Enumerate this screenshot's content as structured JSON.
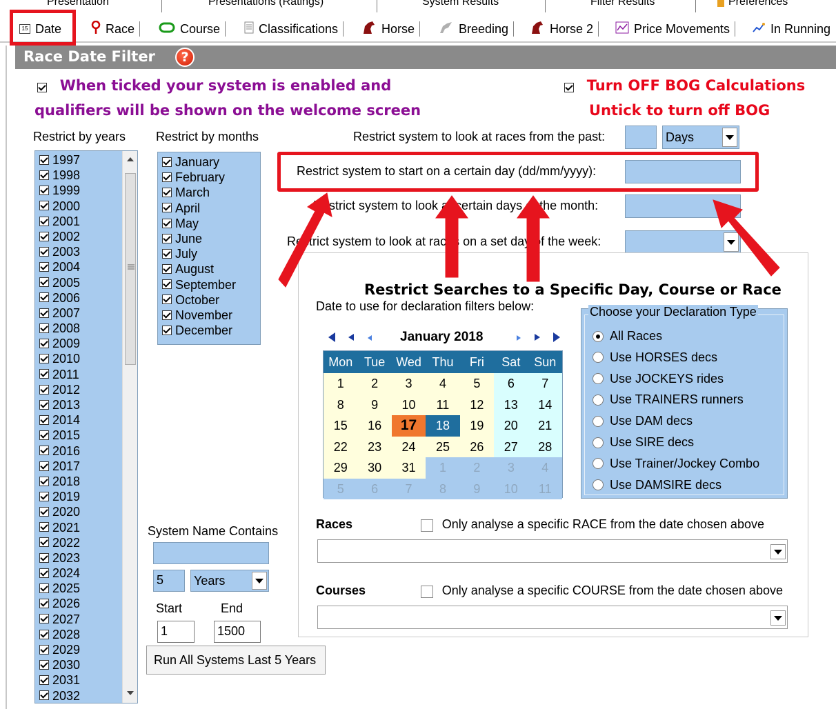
{
  "top_tabs": [
    {
      "label": "Presentation"
    },
    {
      "label": "Presentations (Ratings)"
    },
    {
      "label": "System Results"
    },
    {
      "label": "Filter Results"
    },
    {
      "label": "Preferences"
    }
  ],
  "tabs": [
    {
      "label": "Date",
      "icon": "calendar-icon"
    },
    {
      "label": "Race",
      "icon": "pin-icon"
    },
    {
      "label": "Course",
      "icon": "course-icon"
    },
    {
      "label": "Classifications",
      "icon": "document-icon"
    },
    {
      "label": "Horse",
      "icon": "horse-icon"
    },
    {
      "label": "Breeding",
      "icon": "breeding-icon"
    },
    {
      "label": "Horse 2",
      "icon": "horse-icon"
    },
    {
      "label": "Price Movements",
      "icon": "chart-icon"
    },
    {
      "label": "In Running",
      "icon": "line-chart-icon"
    }
  ],
  "header": {
    "title": "Race Date Filter",
    "help": "?"
  },
  "enable_system": {
    "line1": "When ticked your system is enabled and",
    "line2": "qualifiers will be shown on the welcome screen",
    "checked": true
  },
  "bog": {
    "line1": "Turn OFF BOG Calculations",
    "line2": "Untick to turn off BOG",
    "checked": true
  },
  "years": {
    "label": "Restrict by years",
    "items": [
      "1997",
      "1998",
      "1999",
      "2000",
      "2001",
      "2002",
      "2003",
      "2004",
      "2005",
      "2006",
      "2007",
      "2008",
      "2009",
      "2010",
      "2011",
      "2012",
      "2013",
      "2014",
      "2015",
      "2016",
      "2017",
      "2018",
      "2019",
      "2020",
      "2021",
      "2022",
      "2023",
      "2024",
      "2025",
      "2026",
      "2027",
      "2028",
      "2029",
      "2030",
      "2031",
      "2032"
    ]
  },
  "months": {
    "label": "Restrict by months",
    "items": [
      "January",
      "February",
      "March",
      "April",
      "May",
      "June",
      "July",
      "August",
      "September",
      "October",
      "November",
      "December"
    ]
  },
  "restrict": {
    "past_label": "Restrict system to look at races from the past:",
    "past_value": "",
    "past_unit": "Days",
    "start_label": "Restrict system to start on a certain day (dd/mm/yyyy):",
    "start_value": "",
    "dom_label": "Restrict system to look at certain days of the month:",
    "dom_value": "",
    "dow_label": "Restrict system to look at races on a set day of the week:",
    "dow_value": ""
  },
  "specific": {
    "title": "Restrict Searches to a Specific Day, Course or Race",
    "date_label": "Date to use for declaration filters below:"
  },
  "calendar": {
    "month": "January 2018",
    "days_header": [
      "Mon",
      "Tue",
      "Wed",
      "Thu",
      "Fri",
      "Sat",
      "Sun"
    ],
    "weeks": [
      [
        "1",
        "2",
        "3",
        "4",
        "5",
        "6",
        "7"
      ],
      [
        "8",
        "9",
        "10",
        "11",
        "12",
        "13",
        "14"
      ],
      [
        "15",
        "16",
        "17",
        "18",
        "19",
        "20",
        "21"
      ],
      [
        "22",
        "23",
        "24",
        "25",
        "26",
        "27",
        "28"
      ],
      [
        "29",
        "30",
        "31",
        "1",
        "2",
        "3",
        "4"
      ],
      [
        "5",
        "6",
        "7",
        "8",
        "9",
        "10",
        "11"
      ]
    ],
    "today": "17",
    "selected": "18"
  },
  "declaration": {
    "legend": "Choose your Declaration Type",
    "options": [
      "All Races",
      "Use HORSES decs",
      "Use JOCKEYS rides",
      "Use TRAINERS runners",
      "Use DAM decs",
      "Use SIRE decs",
      "Use Trainer/Jockey Combo",
      "Use DAMSIRE decs"
    ],
    "selected": "All Races"
  },
  "races": {
    "label": "Races",
    "check_label": "Only analyse a specific RACE from the date chosen above",
    "value": ""
  },
  "courses": {
    "label": "Courses",
    "check_label": "Only analyse a specific COURSE from the date chosen above",
    "value": ""
  },
  "system_name": {
    "label": "System Name Contains",
    "value": ""
  },
  "period": {
    "value": "5",
    "unit": "Years"
  },
  "range": {
    "start_label": "Start",
    "end_label": "End",
    "start": "1",
    "end": "1500"
  },
  "run_button": "Run All Systems Last 5 Years",
  "colors": {
    "accent_blue": "#a8cbee",
    "calendar_header": "#1f6e9e",
    "today": "#f0772e",
    "annotation_red": "#e6141e",
    "purple": "#8b0e94"
  }
}
